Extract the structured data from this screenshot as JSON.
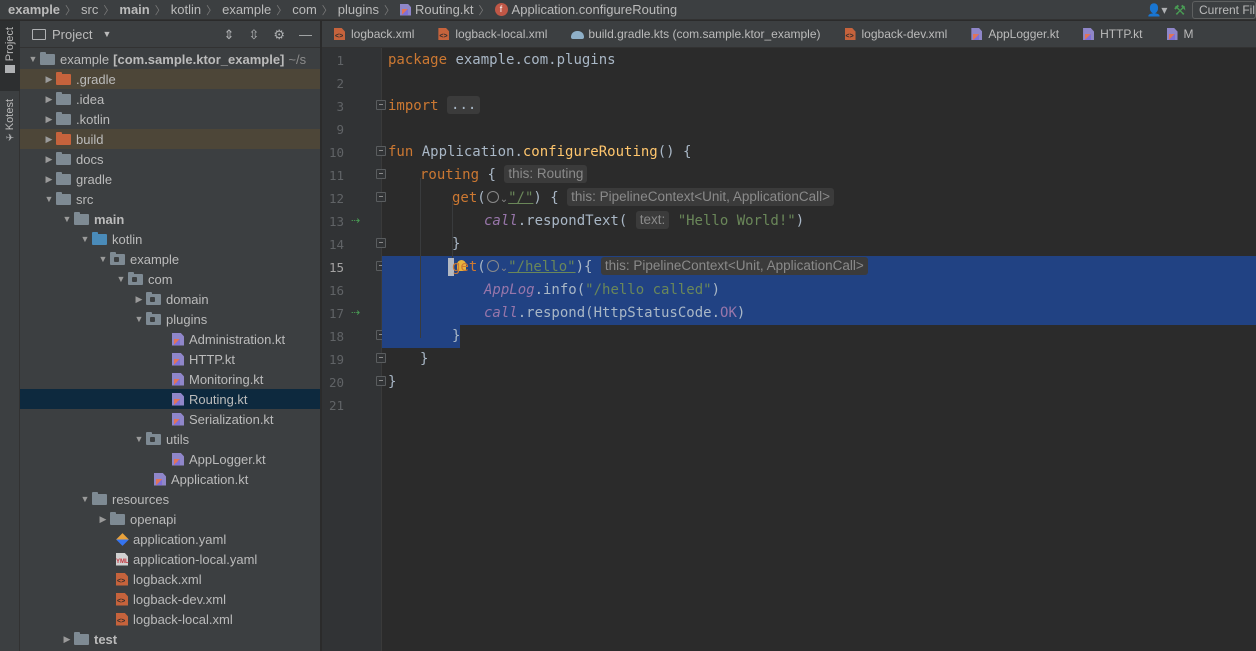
{
  "navbar": {
    "crumbs": [
      "example",
      "src",
      "main",
      "kotlin",
      "example",
      "com",
      "plugins"
    ],
    "file": "Routing.kt",
    "function": "Application.configureRouting",
    "current_file_btn": "Current File"
  },
  "leftbar": {
    "project": "Project",
    "kotest": "Kotest"
  },
  "project_panel": {
    "title": "Project",
    "root_label": "example",
    "root_module": "[com.sample.ktor_example]",
    "root_path": "~/s",
    "items": [
      {
        "label": ".gradle"
      },
      {
        "label": ".idea"
      },
      {
        "label": ".kotlin"
      },
      {
        "label": "build"
      },
      {
        "label": "docs"
      },
      {
        "label": "gradle"
      },
      {
        "label": "src"
      },
      {
        "label": "main"
      },
      {
        "label": "kotlin"
      },
      {
        "label": "example"
      },
      {
        "label": "com"
      },
      {
        "label": "domain"
      },
      {
        "label": "plugins"
      },
      {
        "label": "Administration.kt"
      },
      {
        "label": "HTTP.kt"
      },
      {
        "label": "Monitoring.kt"
      },
      {
        "label": "Routing.kt"
      },
      {
        "label": "Serialization.kt"
      },
      {
        "label": "utils"
      },
      {
        "label": "AppLogger.kt"
      },
      {
        "label": "Application.kt"
      },
      {
        "label": "resources"
      },
      {
        "label": "openapi"
      },
      {
        "label": "application.yaml"
      },
      {
        "label": "application-local.yaml"
      },
      {
        "label": "logback.xml"
      },
      {
        "label": "logback-dev.xml"
      },
      {
        "label": "logback-local.xml"
      },
      {
        "label": "test"
      }
    ]
  },
  "tabs": [
    "logback.xml",
    "logback-local.xml",
    "build.gradle.kts (com.sample.ktor_example)",
    "logback-dev.xml",
    "AppLogger.kt",
    "HTTP.kt",
    "M"
  ],
  "line_numbers": [
    "1",
    "2",
    "3",
    "9",
    "10",
    "11",
    "12",
    "13",
    "14",
    "15",
    "16",
    "17",
    "18",
    "19",
    "20",
    "21"
  ],
  "code": {
    "package_kw": "package",
    "package_name": " example.com.plugins",
    "import_kw": "import",
    "import_fold": "...",
    "fun_kw": "fun",
    "receiver": " Application.",
    "fn_name": "configureRouting",
    "fn_tail": "() {",
    "routing": "routing",
    "routing_brace": " {",
    "hint_routing": "this: Routing",
    "get": "get",
    "paren_open": "(",
    "root_path": "\"/\"",
    "after_root": ") {",
    "hint_ctx": "this: PipelineContext<Unit, ApplicationCall>",
    "call": "call",
    "respond_text": ".respondText(",
    "hint_text": "text:",
    "hello_world": "\"Hello World!\"",
    "close_paren": ")",
    "close_brace": "}",
    "hello_path": "\"/hello\"",
    "after_hello": "){",
    "applog": "AppLog",
    "info": ".info(",
    "hello_called": "\"/hello called\"",
    "respond": ".respond(HttpStatusCode.",
    "ok": "OK",
    "respond_tail": ")"
  }
}
